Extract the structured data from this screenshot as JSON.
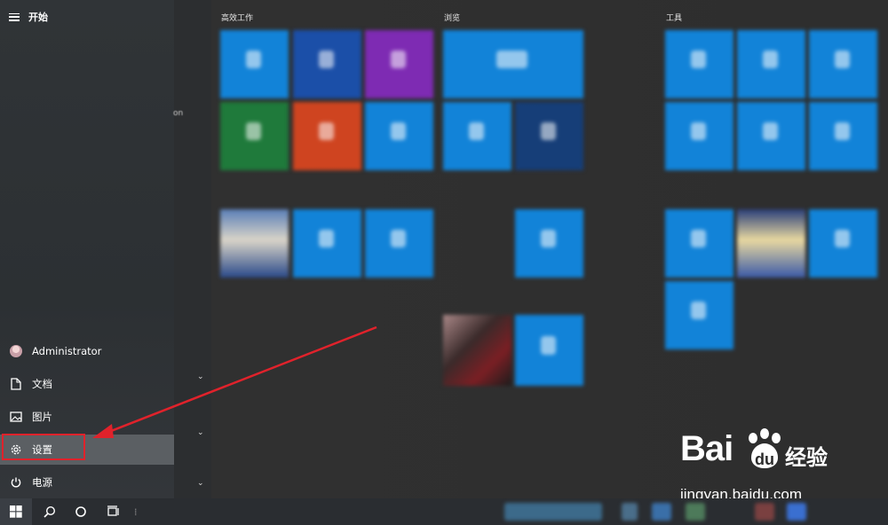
{
  "start_menu": {
    "title": "开始",
    "rail": {
      "user": "Administrator",
      "documents": "文档",
      "pictures": "图片",
      "settings": "设置",
      "power": "电源"
    },
    "groups": [
      {
        "label": "高效工作"
      },
      {
        "label": "浏览"
      },
      {
        "label": "工具"
      }
    ],
    "partial_text": "on"
  },
  "watermark": {
    "brand": "Bai",
    "brand_cn": "经验",
    "url": "jingyan.baidu.com"
  },
  "colors": {
    "tile_blue": "#1283d8",
    "highlight_red": "#e0222b",
    "arrow_red": "#e0222b",
    "active_item": "#5b5f63"
  }
}
